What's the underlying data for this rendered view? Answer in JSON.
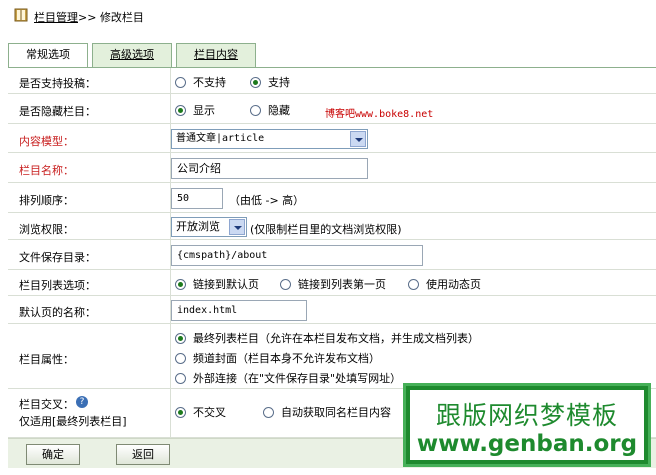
{
  "breadcrumb": {
    "section": "栏目管理",
    "separator": ">>",
    "page": "修改栏目"
  },
  "tabs": [
    {
      "label": "常规选项",
      "active": true
    },
    {
      "label": "高级选项",
      "active": false
    },
    {
      "label": "栏目内容",
      "active": false
    }
  ],
  "form": {
    "allow_submit": {
      "label": "是否支持投稿：",
      "options": [
        "不支持",
        "支持"
      ],
      "selected": "支持"
    },
    "hidden": {
      "label": "是否隐藏栏目：",
      "options": [
        "显示",
        "隐藏"
      ],
      "selected": "显示",
      "note": "博客吧www.boke8.net"
    },
    "content_model": {
      "label": "内容模型：",
      "value": "普通文章|article"
    },
    "name": {
      "label": "栏目名称：",
      "value": "公司介绍"
    },
    "sort_order": {
      "label": "排列顺序：",
      "value": "50",
      "hint": "（由低 -> 高）"
    },
    "browse_permission": {
      "label": "浏览权限：",
      "value": "开放浏览",
      "hint": "(仅限制栏目里的文档浏览权限)"
    },
    "save_dir": {
      "label": "文件保存目录：",
      "value": "{cmspath}/about"
    },
    "list_option": {
      "label": "栏目列表选项：",
      "options": [
        "链接到默认页",
        "链接到列表第一页",
        "使用动态页"
      ],
      "selected": "链接到默认页"
    },
    "default_page": {
      "label": "默认页的名称：",
      "value": "index.html"
    },
    "attribute": {
      "label": "栏目属性：",
      "options": [
        "最终列表栏目（允许在本栏目发布文档，并生成文档列表）",
        "频道封面（栏目本身不允许发布文档）",
        "外部连接（在\"文件保存目录\"处填写网址）"
      ],
      "selected": "最终列表栏目（允许在本栏目发布文档，并生成文档列表）"
    },
    "cross": {
      "label": "栏目交叉：",
      "sublabel": "仅适用[最终列表栏目]",
      "options": [
        "不交叉",
        "自动获取同名栏目内容"
      ],
      "selected": "不交叉"
    }
  },
  "buttons": {
    "ok": "确定",
    "back": "返回"
  },
  "brand": {
    "line1": "跟版网织梦模板",
    "line2": "www.genban.org"
  },
  "colors": {
    "tab_bg": "#e3f0dc",
    "required_label": "#c82020",
    "brand_green": "#1e8a2e"
  }
}
